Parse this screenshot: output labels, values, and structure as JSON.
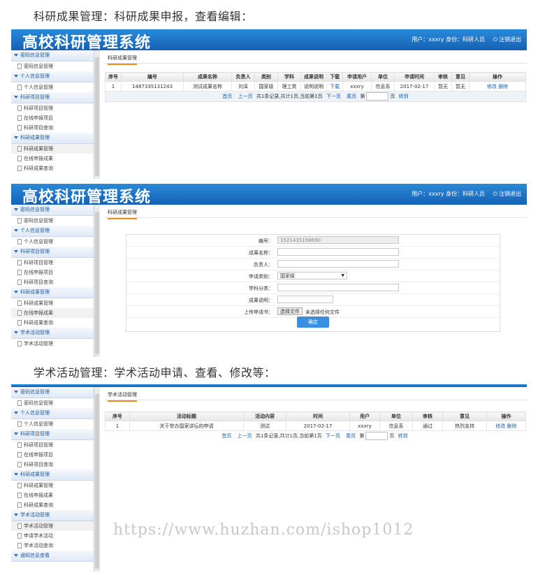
{
  "captions": {
    "c1": "科研成果管理：科研成果申报，查看编辑：",
    "c2": "学术活动管理：学术活动申请、查看、修改等："
  },
  "app": {
    "title": "高校科研管理系统",
    "user_info": "用户：xxxry 身份：科研人员",
    "logout": "注销退出"
  },
  "sidebar": {
    "groups": [
      {
        "label": "密码信息管理",
        "items": [
          "密码信息管理"
        ]
      },
      {
        "label": "个人信息管理",
        "items": [
          "个人信息管理"
        ]
      },
      {
        "label": "科研项目管理",
        "items": [
          "科研项目管理",
          "在线申报项目",
          "科研项目查询"
        ]
      },
      {
        "label": "科研成果管理",
        "items": [
          "科研成果管理",
          "在线申报成果",
          "科研成果查询"
        ]
      },
      {
        "label": "学术活动管理",
        "items": [
          "学术活动管理",
          "申请学术活动",
          "学术活动查询"
        ]
      },
      {
        "label": "通知信息查看",
        "items": []
      }
    ]
  },
  "screen1": {
    "tab": "科研成果管理",
    "headers": [
      "序号",
      "编号",
      "成果名称",
      "负责人",
      "类别",
      "学科",
      "成果说明",
      "下载",
      "申请用户",
      "单位",
      "申请时间",
      "审核",
      "意见",
      "操作"
    ],
    "row": [
      "1",
      "1487335131243",
      "测试成果名称",
      "刘泽",
      "国家级",
      "理工类",
      "说明说明",
      "下载",
      "xxxry",
      "信息系",
      "2017-02-17",
      "暂无",
      "暂无",
      "修改 删除"
    ],
    "pager": {
      "first": "首页",
      "prev": "上一页",
      "info": "共1条记录,共计1页,当前第1页",
      "next": "下一页",
      "last": "尾页",
      "page_label": "第",
      "page_suffix": "页",
      "go": "转到"
    }
  },
  "screen2": {
    "tab": "科研成果管理",
    "fields": {
      "id_label": "编号：",
      "id_value": "1521435198690",
      "name_label": "成果名称：",
      "owner_label": "负责人：",
      "category_label": "申请类别：",
      "category_value": "国家级",
      "subject_label": "学科分类：",
      "desc_label": "成果说明：",
      "upload_label": "上传申请书：",
      "upload_button": "选择文件",
      "upload_status": "未选择任何文件"
    },
    "submit": "确定"
  },
  "screen3": {
    "tab": "学术活动管理",
    "headers": [
      "序号",
      "活动标题",
      "活动内容",
      "时间",
      "用户",
      "单位",
      "审核",
      "意见",
      "操作"
    ],
    "row": [
      "1",
      "关于举办国家讲坛的申请",
      "测试",
      "2017-02-17",
      "xxxry",
      "信息系",
      "通过",
      "热烈支持",
      "修改 删除"
    ],
    "pager": {
      "first": "首页",
      "prev": "上一页",
      "info": "共1条记录,共计1页,当前第1页",
      "next": "下一页",
      "last": "尾页",
      "page_label": "第",
      "page_suffix": "页",
      "go": "转到"
    }
  },
  "watermark": "https://www.huzhan.com/ishop1012"
}
